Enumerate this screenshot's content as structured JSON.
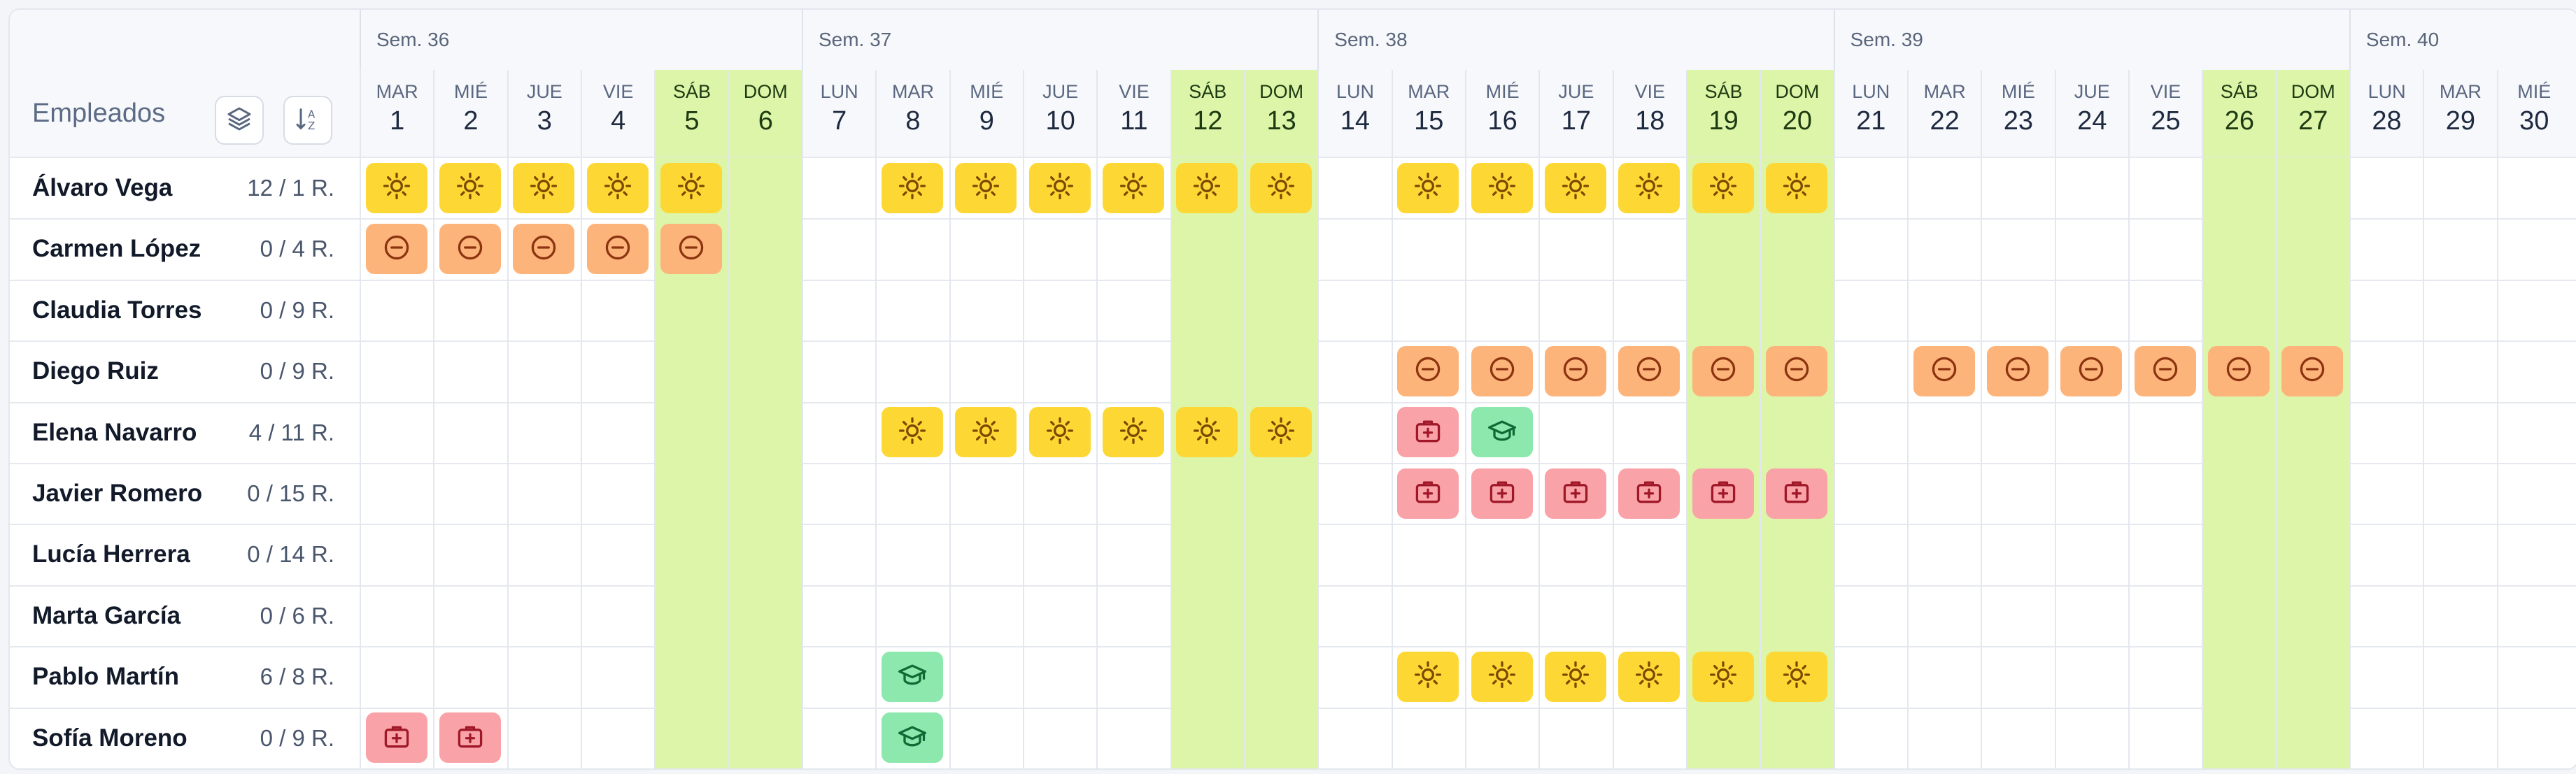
{
  "employees_title": "Empleados",
  "icons": {
    "layers_button": "layers-icon",
    "sort_button": "sort-az-icon"
  },
  "legend_icons": {
    "vac": "sun-icon",
    "neg": "minus-circle-icon",
    "sick": "medical-case-icon",
    "train": "graduation-cap-icon"
  },
  "colors": {
    "weekend": "#dcf5a8",
    "vac": "#fdd835",
    "neg": "#fdb47b",
    "sick": "#f9a3a8",
    "train": "#8ce8ad"
  },
  "weeks": [
    {
      "label": "Sem. 36",
      "start": 0,
      "span": 6
    },
    {
      "label": "Sem. 37",
      "start": 6,
      "span": 7
    },
    {
      "label": "Sem. 38",
      "start": 13,
      "span": 7
    },
    {
      "label": "Sem. 39",
      "start": 20,
      "span": 7
    },
    {
      "label": "Sem. 40",
      "start": 27,
      "span": 3
    }
  ],
  "days": [
    {
      "dow": "MAR",
      "num": "1",
      "we": false
    },
    {
      "dow": "MIÉ",
      "num": "2",
      "we": false
    },
    {
      "dow": "JUE",
      "num": "3",
      "we": false
    },
    {
      "dow": "VIE",
      "num": "4",
      "we": false
    },
    {
      "dow": "SÁB",
      "num": "5",
      "we": true
    },
    {
      "dow": "DOM",
      "num": "6",
      "we": true
    },
    {
      "dow": "LUN",
      "num": "7",
      "we": false
    },
    {
      "dow": "MAR",
      "num": "8",
      "we": false
    },
    {
      "dow": "MIÉ",
      "num": "9",
      "we": false
    },
    {
      "dow": "JUE",
      "num": "10",
      "we": false
    },
    {
      "dow": "VIE",
      "num": "11",
      "we": false
    },
    {
      "dow": "SÁB",
      "num": "12",
      "we": true
    },
    {
      "dow": "DOM",
      "num": "13",
      "we": true
    },
    {
      "dow": "LUN",
      "num": "14",
      "we": false
    },
    {
      "dow": "MAR",
      "num": "15",
      "we": false
    },
    {
      "dow": "MIÉ",
      "num": "16",
      "we": false
    },
    {
      "dow": "JUE",
      "num": "17",
      "we": false
    },
    {
      "dow": "VIE",
      "num": "18",
      "we": false
    },
    {
      "dow": "SÁB",
      "num": "19",
      "we": true
    },
    {
      "dow": "DOM",
      "num": "20",
      "we": true
    },
    {
      "dow": "LUN",
      "num": "21",
      "we": false
    },
    {
      "dow": "MAR",
      "num": "22",
      "we": false
    },
    {
      "dow": "MIÉ",
      "num": "23",
      "we": false
    },
    {
      "dow": "JUE",
      "num": "24",
      "we": false
    },
    {
      "dow": "VIE",
      "num": "25",
      "we": false
    },
    {
      "dow": "SÁB",
      "num": "26",
      "we": true
    },
    {
      "dow": "DOM",
      "num": "27",
      "we": true
    },
    {
      "dow": "LUN",
      "num": "28",
      "we": false
    },
    {
      "dow": "MAR",
      "num": "29",
      "we": false
    },
    {
      "dow": "MIÉ",
      "num": "30",
      "we": false
    }
  ],
  "employees": [
    {
      "name": "Álvaro Vega",
      "count": "12 / 1 R.",
      "absences": [
        [
          0,
          "vac"
        ],
        [
          1,
          "vac"
        ],
        [
          2,
          "vac"
        ],
        [
          3,
          "vac"
        ],
        [
          4,
          "vac"
        ],
        [
          7,
          "vac"
        ],
        [
          8,
          "vac"
        ],
        [
          9,
          "vac"
        ],
        [
          10,
          "vac"
        ],
        [
          11,
          "vac"
        ],
        [
          12,
          "vac"
        ],
        [
          14,
          "vac"
        ],
        [
          15,
          "vac"
        ],
        [
          16,
          "vac"
        ],
        [
          17,
          "vac"
        ],
        [
          18,
          "vac"
        ],
        [
          19,
          "vac"
        ]
      ]
    },
    {
      "name": "Carmen López",
      "count": "0 / 4 R.",
      "absences": [
        [
          0,
          "neg"
        ],
        [
          1,
          "neg"
        ],
        [
          2,
          "neg"
        ],
        [
          3,
          "neg"
        ],
        [
          4,
          "neg"
        ]
      ]
    },
    {
      "name": "Claudia Torres",
      "count": "0 / 9 R.",
      "absences": []
    },
    {
      "name": "Diego Ruiz",
      "count": "0 / 9 R.",
      "absences": [
        [
          14,
          "neg"
        ],
        [
          15,
          "neg"
        ],
        [
          16,
          "neg"
        ],
        [
          17,
          "neg"
        ],
        [
          18,
          "neg"
        ],
        [
          19,
          "neg"
        ],
        [
          21,
          "neg"
        ],
        [
          22,
          "neg"
        ],
        [
          23,
          "neg"
        ],
        [
          24,
          "neg"
        ],
        [
          25,
          "neg"
        ],
        [
          26,
          "neg"
        ]
      ]
    },
    {
      "name": "Elena Navarro",
      "count": "4 / 11 R.",
      "absences": [
        [
          7,
          "vac"
        ],
        [
          8,
          "vac"
        ],
        [
          9,
          "vac"
        ],
        [
          10,
          "vac"
        ],
        [
          11,
          "vac"
        ],
        [
          12,
          "vac"
        ],
        [
          14,
          "sick"
        ],
        [
          15,
          "train"
        ]
      ]
    },
    {
      "name": "Javier Romero",
      "count": "0 / 15 R.",
      "absences": [
        [
          14,
          "sick"
        ],
        [
          15,
          "sick"
        ],
        [
          16,
          "sick"
        ],
        [
          17,
          "sick"
        ],
        [
          18,
          "sick"
        ],
        [
          19,
          "sick"
        ]
      ]
    },
    {
      "name": "Lucía Herrera",
      "count": "0 / 14 R.",
      "absences": []
    },
    {
      "name": "Marta García",
      "count": "0 / 6 R.",
      "absences": []
    },
    {
      "name": "Pablo Martín",
      "count": "6 / 8 R.",
      "absences": [
        [
          7,
          "train"
        ],
        [
          14,
          "vac"
        ],
        [
          15,
          "vac"
        ],
        [
          16,
          "vac"
        ],
        [
          17,
          "vac"
        ],
        [
          18,
          "vac"
        ],
        [
          19,
          "vac"
        ]
      ]
    },
    {
      "name": "Sofía Moreno",
      "count": "0 / 9 R.",
      "absences": [
        [
          0,
          "sick"
        ],
        [
          1,
          "sick"
        ],
        [
          7,
          "train"
        ]
      ]
    }
  ]
}
